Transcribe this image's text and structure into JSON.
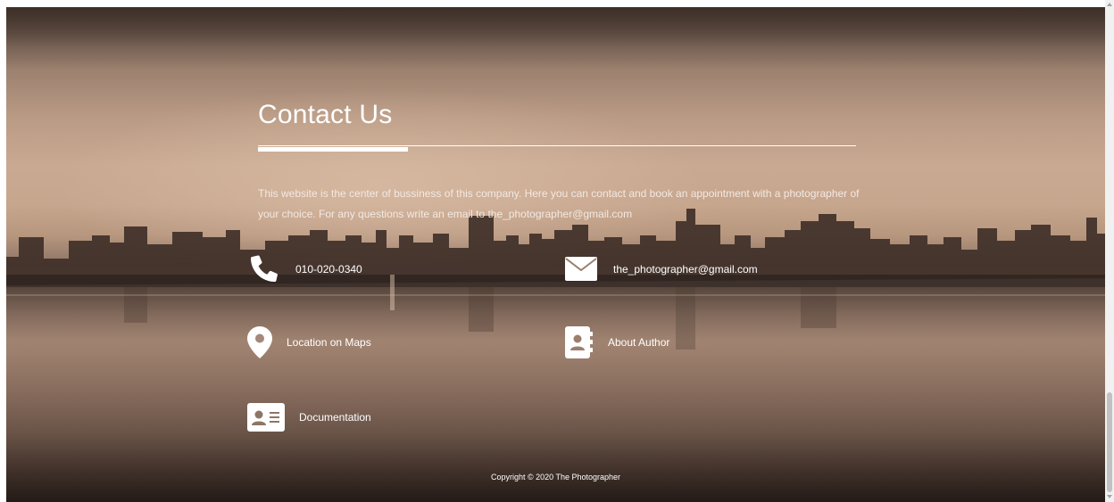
{
  "contact": {
    "title": "Contact Us",
    "description": "This website is the center of bussiness of this company. Here you can contact and book an appointment with a photographer of your choice. For any questions write an email to the_photographer@gmail.com",
    "items": [
      {
        "icon": "phone-icon",
        "label": "010-020-0340"
      },
      {
        "icon": "envelope-icon",
        "label": "the_photographer@gmail.com"
      },
      {
        "icon": "map-marker-icon",
        "label": "Location on Maps"
      },
      {
        "icon": "address-book-icon",
        "label": "About Author"
      },
      {
        "icon": "id-card-icon",
        "label": "Documentation"
      }
    ]
  },
  "footer": {
    "copyright": "Copyright © 2020 The Photographer"
  },
  "colors": {
    "text": "#ffffff",
    "sky": "#c9a992",
    "water": "#9c7f6d"
  }
}
